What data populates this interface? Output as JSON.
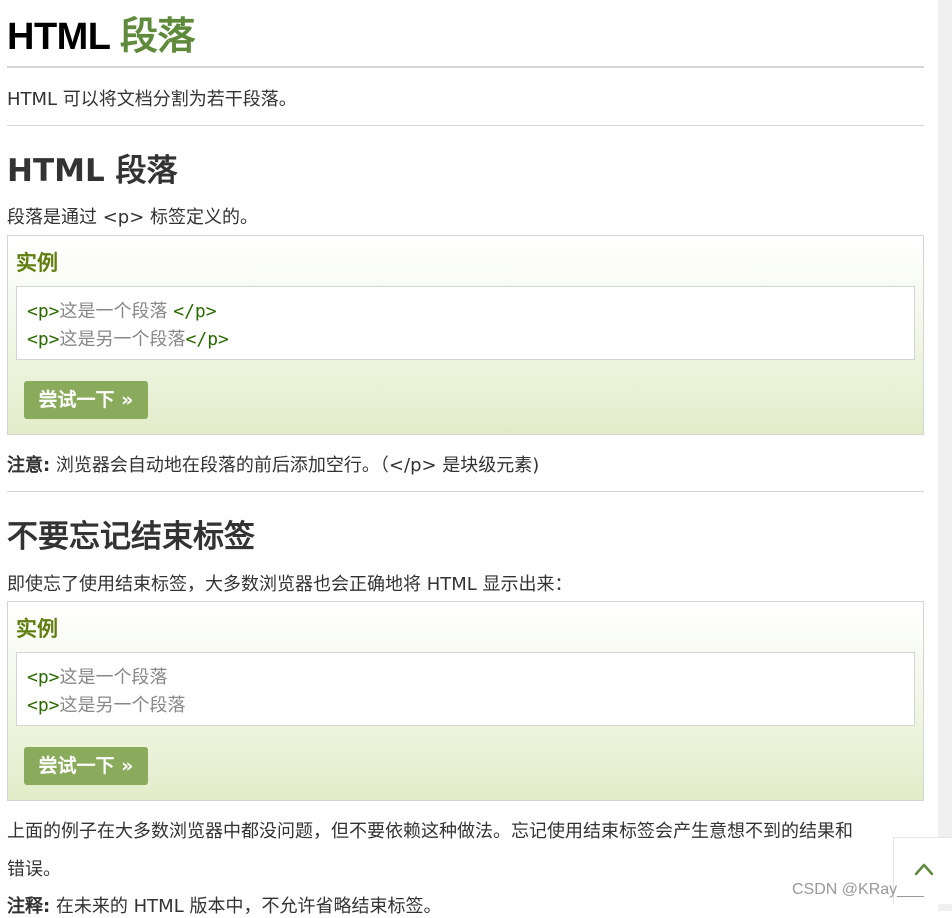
{
  "page": {
    "title_prefix": "HTML",
    "title_accent": "段落",
    "intro": "HTML 可以将文档分割为若干段落。"
  },
  "section1": {
    "heading": "HTML 段落",
    "description": "段落是通过 <p> 标签定义的。",
    "example": {
      "title": "实例",
      "lines": [
        {
          "open_tag": "<p>",
          "text": "这是一个段落 ",
          "close_tag": "</p>"
        },
        {
          "open_tag": "<p>",
          "text": "这是另一个段落",
          "close_tag": "</p>"
        }
      ],
      "button_label": "尝试一下 »"
    },
    "note_label": "注意:",
    "note_text": " 浏览器会自动地在段落的前后添加空行。（</p> 是块级元素)"
  },
  "section2": {
    "heading": "不要忘记结束标签",
    "description": "即使忘了使用结束标签，大多数浏览器也会正确地将 HTML 显示出来：",
    "example": {
      "title": "实例",
      "lines": [
        {
          "open_tag": "<p>",
          "text": "这是一个段落"
        },
        {
          "open_tag": "<p>",
          "text": "这是另一个段落"
        }
      ],
      "button_label": "尝试一下 »"
    },
    "para_line1": "上面的例子在大多数浏览器中都没问题，但不要依赖这种做法。忘记使用结束标签会产生意想不到的结果和",
    "para_line2": "错误。",
    "note_label": "注释:",
    "note_text": " 在未来的 HTML 版本中，不允许省略结束标签。"
  },
  "widgets": {
    "back_to_top_icon": "chevron-up-icon",
    "watermark": "CSDN @KRay___"
  },
  "colors": {
    "accent_green": "#5f8a3b",
    "example_title": "#617f10",
    "button_bg": "#8aab5c",
    "code_tag": "#2a6a00"
  }
}
